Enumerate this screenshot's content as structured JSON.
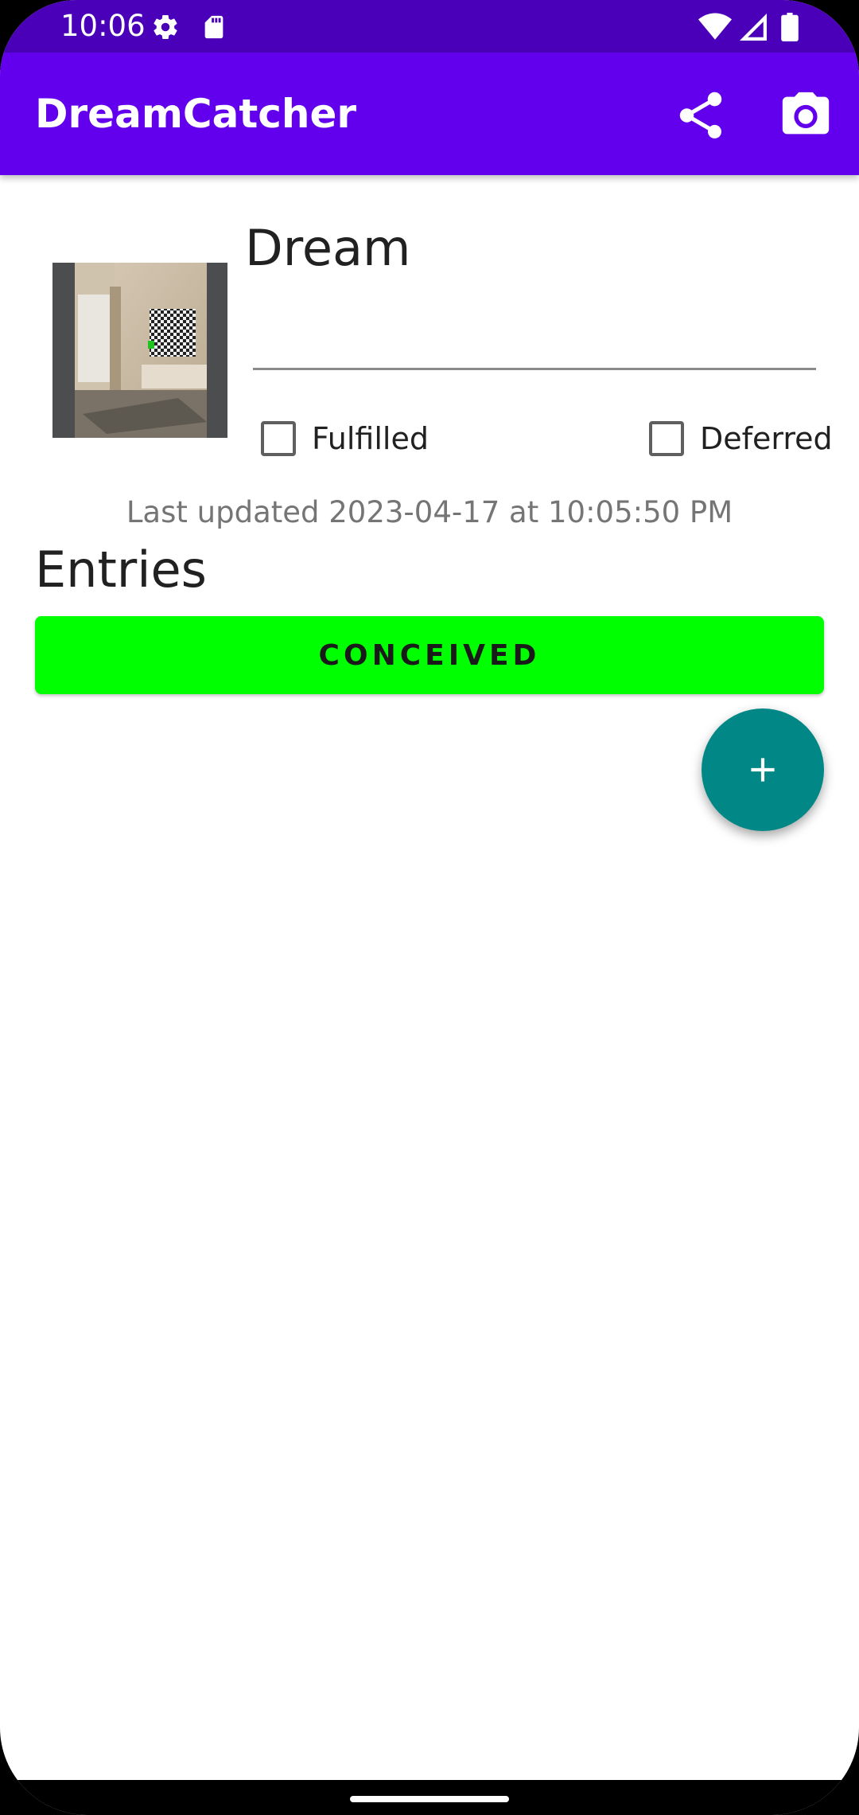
{
  "status_bar": {
    "time": "10:06",
    "left_icons": [
      "gear-icon",
      "sd-card-icon"
    ],
    "right_icons": [
      "wifi-icon",
      "cell-signal-icon",
      "battery-icon"
    ]
  },
  "app_bar": {
    "title": "DreamCatcher",
    "actions": [
      "share-icon",
      "camera-icon"
    ],
    "color": "#6200ee"
  },
  "dream": {
    "label": "Dream",
    "input_value": "",
    "fulfilled_label": "Fulfilled",
    "fulfilled_checked": false,
    "deferred_label": "Deferred",
    "deferred_checked": false,
    "last_updated": "Last updated 2023-04-17 at 10:05:50 PM"
  },
  "entries": {
    "title": "Entries",
    "items": [
      {
        "label": "CONCEIVED",
        "color": "#00ff00"
      }
    ]
  },
  "fab": {
    "icon": "plus-icon",
    "color": "#018786"
  }
}
